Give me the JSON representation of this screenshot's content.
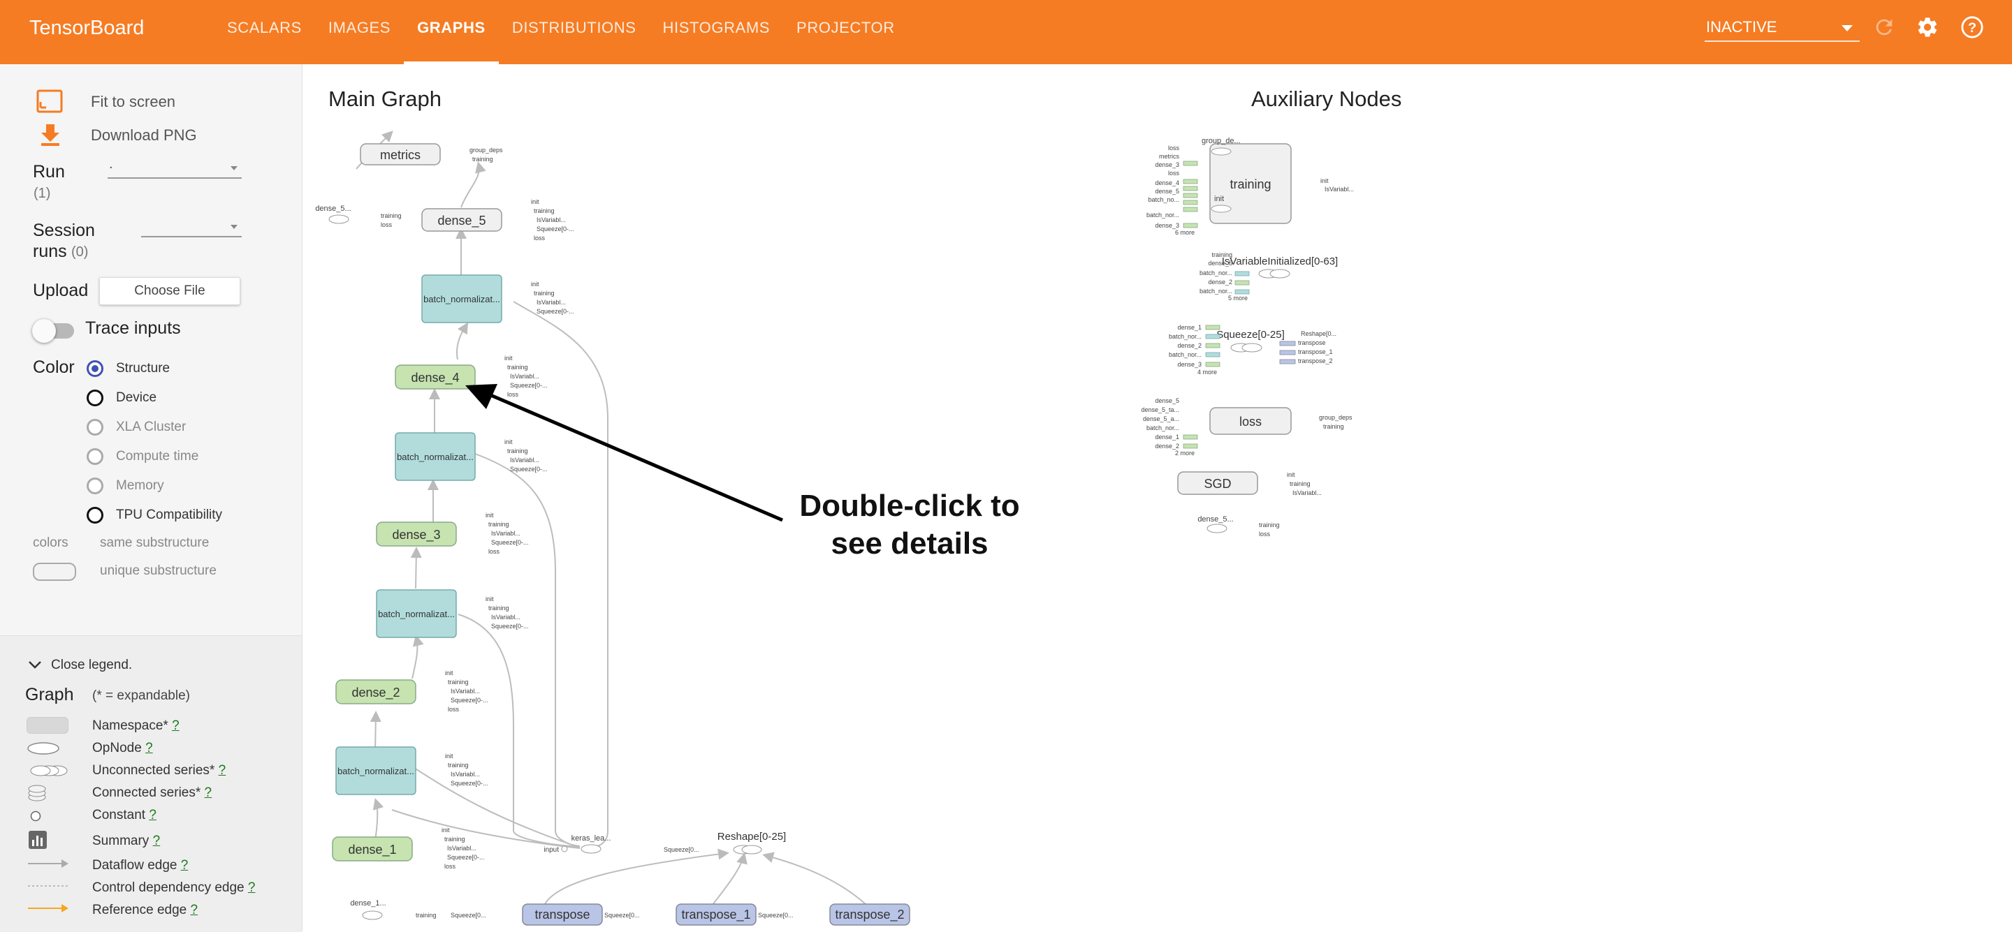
{
  "header": {
    "brand": "TensorBoard",
    "tabs": [
      {
        "label": "SCALARS"
      },
      {
        "label": "IMAGES"
      },
      {
        "label": "GRAPHS"
      },
      {
        "label": "DISTRIBUTIONS"
      },
      {
        "label": "HISTOGRAMS"
      },
      {
        "label": "PROJECTOR"
      }
    ],
    "active_tab": "GRAPHS",
    "run_select": "INACTIVE",
    "icons": [
      "refresh-icon",
      "settings-icon",
      "help-icon"
    ],
    "color": "#f57c23"
  },
  "sidebar": {
    "fit_to_screen": "Fit to screen",
    "download_png": "Download PNG",
    "run_label": "Run",
    "run_count": "(1)",
    "run_value": ".",
    "session_label_1": "Session",
    "session_label_2": "runs",
    "session_count": "(0)",
    "upload_label": "Upload",
    "choose_file": "Choose File",
    "trace_inputs": "Trace inputs",
    "color_label": "Color",
    "color_options": [
      "Structure",
      "Device",
      "XLA Cluster",
      "Compute time",
      "Memory",
      "TPU Compatibility"
    ],
    "color_selected": "Structure",
    "colors_label": "colors",
    "same_substructure": "same substructure",
    "unique_substructure": "unique substructure"
  },
  "legend": {
    "close": "Close legend.",
    "graph": "Graph",
    "expandable": "(* = expandable)",
    "q": "?",
    "items": [
      {
        "label": "Namespace*"
      },
      {
        "label": "OpNode"
      },
      {
        "label": "Unconnected series*"
      },
      {
        "label": "Connected series*"
      },
      {
        "label": "Constant"
      },
      {
        "label": "Summary"
      },
      {
        "label": "Dataflow edge"
      },
      {
        "label": "Control dependency edge"
      },
      {
        "label": "Reference edge"
      }
    ]
  },
  "main_graph": {
    "title": "Main Graph",
    "nodes": {
      "metrics": "metrics",
      "dense_5": "dense_5",
      "bn": "batch_normalizat...",
      "dense_4": "dense_4",
      "dense_3": "dense_3",
      "dense_2": "dense_2",
      "dense_1": "dense_1",
      "transpose": "transpose",
      "transpose_1": "transpose_1",
      "transpose_2": "transpose_2",
      "reshape": "Reshape[0-25]",
      "keras_lea": "keras_lea...",
      "input": "input",
      "dense_5_small": "dense_5...",
      "dense_1_small": "dense_1...",
      "squeeze": "Squeeze[0..."
    },
    "mini_labels": {
      "init": "init",
      "training": "training",
      "isvariable": "IsVariabl...",
      "squeeze": "Squeeze[0-...",
      "loss": "loss",
      "group_deps": "group_deps"
    },
    "annotation": "Double-click to\nsee details",
    "annotation_line1": "Double-click to",
    "annotation_line2": "see details"
  },
  "aux_nodes": {
    "title": "Auxiliary Nodes",
    "training": "training",
    "is_var_init": "IsVariableInitialized[0-63]",
    "squeeze": "Squeeze[0-25]",
    "loss": "loss",
    "sgd": "SGD",
    "dense_5": "dense_5...",
    "group_de": "group_de...",
    "init": "init",
    "isvariable": "IsVariabl...",
    "inputs_a": [
      "loss",
      "metrics",
      "dense_3",
      "loss",
      "dense_4",
      "dense_5",
      "batch_no...",
      "batch_nor...",
      "dense_3"
    ],
    "more_6": "6 more",
    "inputs_b": [
      "training",
      "dense_5",
      "batch_nor...",
      "dense_2",
      "batch_nor..."
    ],
    "more_5": "5 more",
    "inputs_c": [
      "dense_1",
      "batch_nor...",
      "dense_2",
      "batch_nor...",
      "dense_3"
    ],
    "more_4": "4 more",
    "outputs_c": [
      "Reshape[0...",
      "transpose",
      "transpose_1",
      "transpose_2"
    ],
    "inputs_d": [
      "dense_5",
      "dense_5_ta...",
      "dense_5_a...",
      "batch_nor...",
      "dense_1",
      "dense_2"
    ],
    "more_2": "2 more",
    "group_deps": "group_deps",
    "training_out": "training"
  }
}
